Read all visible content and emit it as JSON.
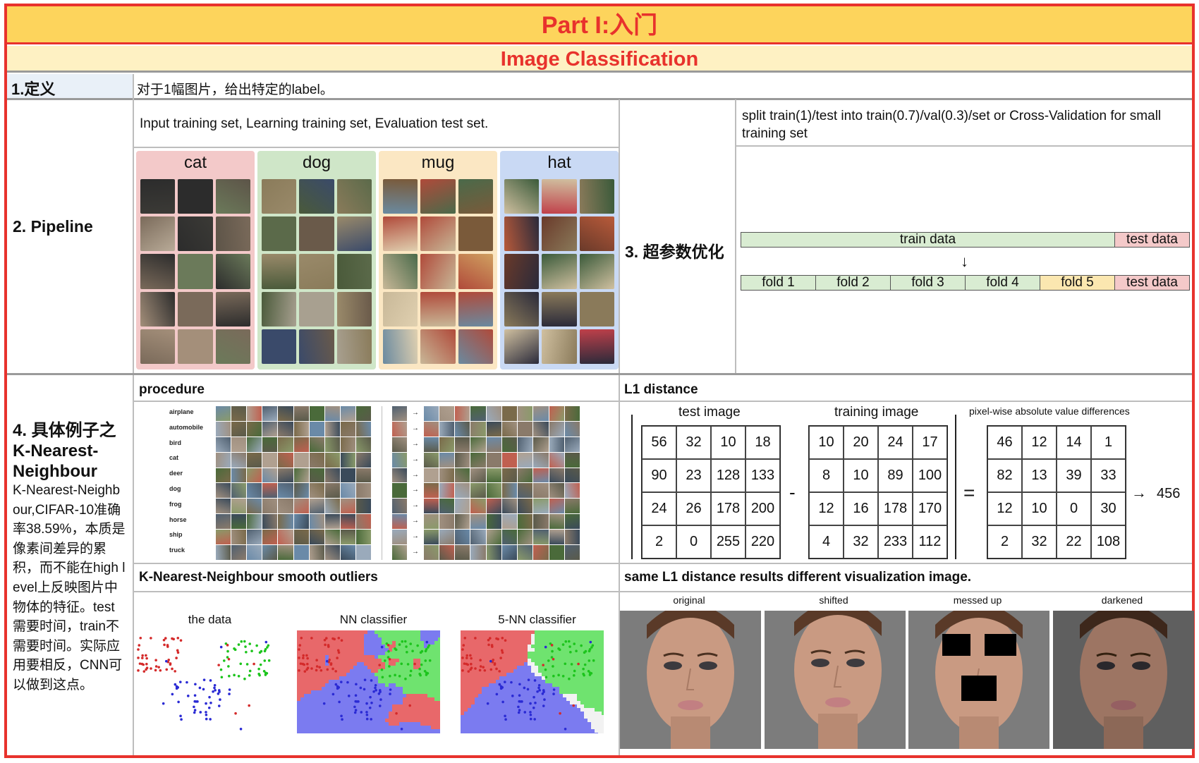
{
  "header": {
    "title": "Part I:入门",
    "subtitle": "Image Classification"
  },
  "definition": {
    "label": "1.定义",
    "text": "对于1幅图片，给出特定的label。"
  },
  "pipeline": {
    "label": "2. Pipeline",
    "description": "Input training set, Learning training set, Evaluation test set.",
    "classes": [
      "cat",
      "dog",
      "mug",
      "hat"
    ],
    "class_colors": [
      "#f3c9c9",
      "#cfe6c8",
      "#fbe7c3",
      "#c9d9f4"
    ]
  },
  "hyperparam": {
    "label": "3. 超参数优化",
    "description": "split train(1)/test into train(0.7)/val(0.3)/set or Cross-Validation for small training set",
    "train_label": "train data",
    "test_label": "test data",
    "folds": [
      "fold 1",
      "fold 2",
      "fold 3",
      "fold 4",
      "fold 5",
      "test data"
    ],
    "arrow": "↓"
  },
  "knn": {
    "label_line1": "4. 具体例子之",
    "label_line2": "K-Nearest-",
    "label_line3": "Neighbour",
    "description": "K-Nearest-Neighbour,CIFAR-10准确率38.59%，本质是像素间差异的累积，而不能在high level上反映图片中物体的特征。test需要时间，train不需要时间。实际应用要相反，CNN可以做到这点。",
    "procedure_label": "procedure",
    "cifar_classes": [
      "airplane",
      "automobile",
      "bird",
      "cat",
      "deer",
      "dog",
      "frog",
      "horse",
      "ship",
      "truck"
    ],
    "smooth_label": "K-Nearest-Neighbour smooth outliers",
    "plots": [
      "the data",
      "NN classifier",
      "5-NN classifier"
    ],
    "plot_colors": {
      "red": "#e8686a",
      "green": "#6fe36f",
      "blue": "#7b7bf0"
    }
  },
  "l1": {
    "label": "L1 distance",
    "test_title": "test image",
    "train_title": "training image",
    "diff_title": "pixel-wise absolute value differences",
    "test": [
      [
        "56",
        "32",
        "10",
        "18"
      ],
      [
        "90",
        "23",
        "128",
        "133"
      ],
      [
        "24",
        "26",
        "178",
        "200"
      ],
      [
        "2",
        "0",
        "255",
        "220"
      ]
    ],
    "train": [
      [
        "10",
        "20",
        "24",
        "17"
      ],
      [
        "8",
        "10",
        "89",
        "100"
      ],
      [
        "12",
        "16",
        "178",
        "170"
      ],
      [
        "4",
        "32",
        "233",
        "112"
      ]
    ],
    "diff": [
      [
        "46",
        "12",
        "14",
        "1"
      ],
      [
        "82",
        "13",
        "39",
        "33"
      ],
      [
        "12",
        "10",
        "0",
        "30"
      ],
      [
        "2",
        "32",
        "22",
        "108"
      ]
    ],
    "minus": "-",
    "equals": "=",
    "result": "456",
    "result_arrow": "→"
  },
  "visualization": {
    "label": "same L1 distance results different visualization image.",
    "captions": [
      "original",
      "shifted",
      "messed up",
      "darkened"
    ]
  }
}
